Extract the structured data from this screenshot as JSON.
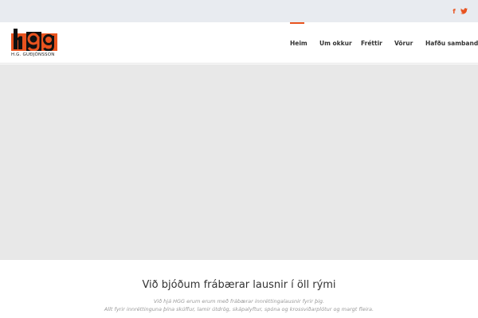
{
  "topbar": {
    "social": [
      {
        "icon": "facebook-icon",
        "glyph": "f",
        "color": "#e8531f"
      },
      {
        "icon": "twitter-icon",
        "color": "#e8531f"
      }
    ]
  },
  "logo": {
    "mark_text": "hgg",
    "tagline": "H.G. GUÐJÓNSSON",
    "colors": {
      "red": "#e8531f",
      "black": "#111111"
    }
  },
  "nav": {
    "items": [
      {
        "label": "Heim",
        "active": true
      },
      {
        "label": "Um okkur",
        "active": false
      },
      {
        "label": "Fréttir",
        "active": false
      },
      {
        "label": "Vörur",
        "active": false
      },
      {
        "label": "Hafðu samband",
        "active": false
      }
    ],
    "accent": "#e8531f"
  },
  "content": {
    "headline": "Við bjóðum frábærar lausnir í öll rými",
    "line1": "Við hjá HGG erum erum með frábærar innréttingalausnir fyrir þig.",
    "line2": "Allt fyrir innréttinguna þína skúffur, lamir útdrög, skápalyftur, spóna og krossviðarplötur og margt fleira."
  }
}
